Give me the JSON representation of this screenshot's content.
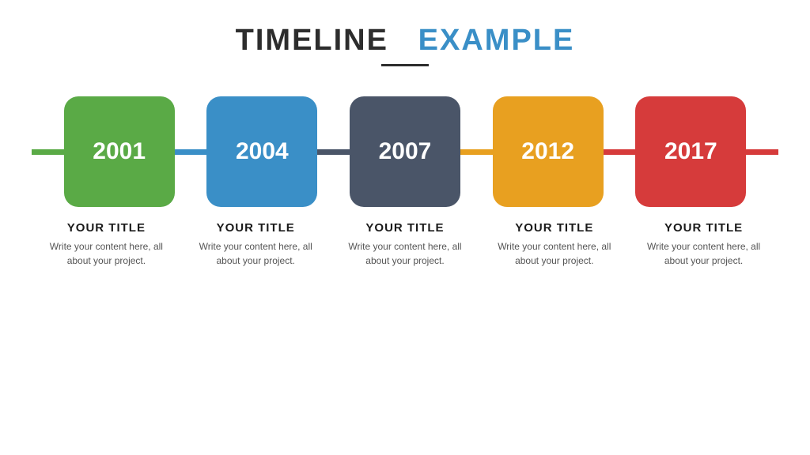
{
  "header": {
    "word_timeline": "TIMELINE",
    "word_example": "EXAMPLE"
  },
  "timeline": {
    "items": [
      {
        "year": "2001",
        "box_class": "box-green",
        "line_class": "line-green",
        "title": "YOUR TITLE",
        "content": "Write your content here, all about your project."
      },
      {
        "year": "2004",
        "box_class": "box-blue",
        "line_class": "line-blue",
        "title": "YOUR TITLE",
        "content": "Write your content here, all about your project."
      },
      {
        "year": "2007",
        "box_class": "box-dark",
        "line_class": "line-dark",
        "title": "YOUR TITLE",
        "content": "Write your content here, all about your project."
      },
      {
        "year": "2012",
        "box_class": "box-orange",
        "line_class": "line-orange",
        "title": "YOUR TITLE",
        "content": "Write your content here, all about your project."
      },
      {
        "year": "2017",
        "box_class": "box-red",
        "line_class": "line-red",
        "title": "YOUR TITLE",
        "content": "Write your content here, all about your project."
      }
    ]
  }
}
